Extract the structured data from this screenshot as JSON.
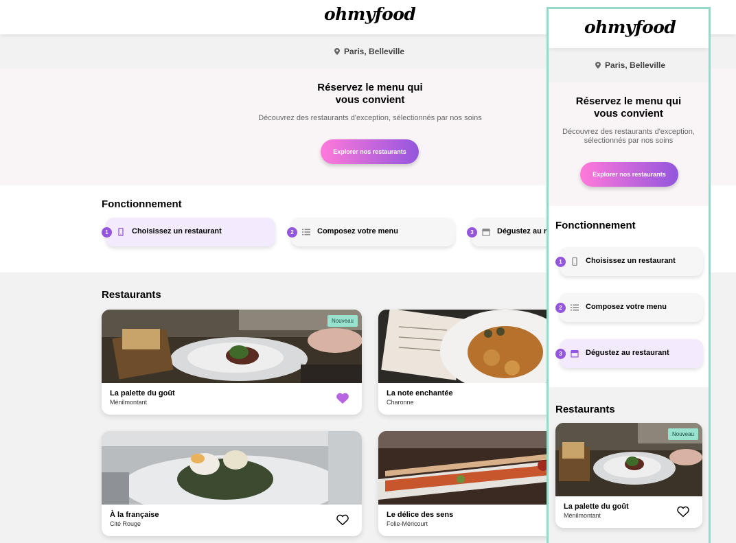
{
  "brand": {
    "logo": "ohmyfood"
  },
  "location": {
    "label": "Paris, Belleville"
  },
  "hero": {
    "title_line1": "Réservez le menu qui",
    "title_line2": "vous convient",
    "subtitle": "Découvrez des restaurants d'exception, sélectionnés par nos soins",
    "subtitle_line1": "Découvrez des restaurants d'exception,",
    "subtitle_line2": "sélectionnés par nos soins",
    "cta": "Explorer nos restaurants"
  },
  "how": {
    "title": "Fonctionnement",
    "steps": [
      {
        "num": "1",
        "label": "Choisissez un restaurant",
        "icon": "mobile-phone-icon"
      },
      {
        "num": "2",
        "label": "Composez votre menu",
        "icon": "list-icon"
      },
      {
        "num": "3",
        "label": "Dégustez au restaurant",
        "desktop_label": "Dégustez au r",
        "icon": "store-icon"
      }
    ]
  },
  "restaurants": {
    "title": "Restaurants",
    "badge": "Nouveau",
    "items": [
      {
        "name": "La palette du goût",
        "area": "Ménilmontant",
        "liked": true,
        "new": true
      },
      {
        "name": "La note enchantée",
        "area": "Charonne",
        "liked": false,
        "new": false
      },
      {
        "name": "À la française",
        "area": "Cité Rouge",
        "liked": false,
        "new": false
      },
      {
        "name": "Le délice des sens",
        "area": "Folie-Méricourt",
        "liked": false,
        "new": false
      }
    ]
  },
  "colors": {
    "gradient_start": "#ff79da",
    "gradient_end": "#9356dc",
    "accent": "#9356dc",
    "badge_bg": "#99e2d0",
    "heart_liked": "#b764e0",
    "panel_border": "#99d8c8"
  }
}
